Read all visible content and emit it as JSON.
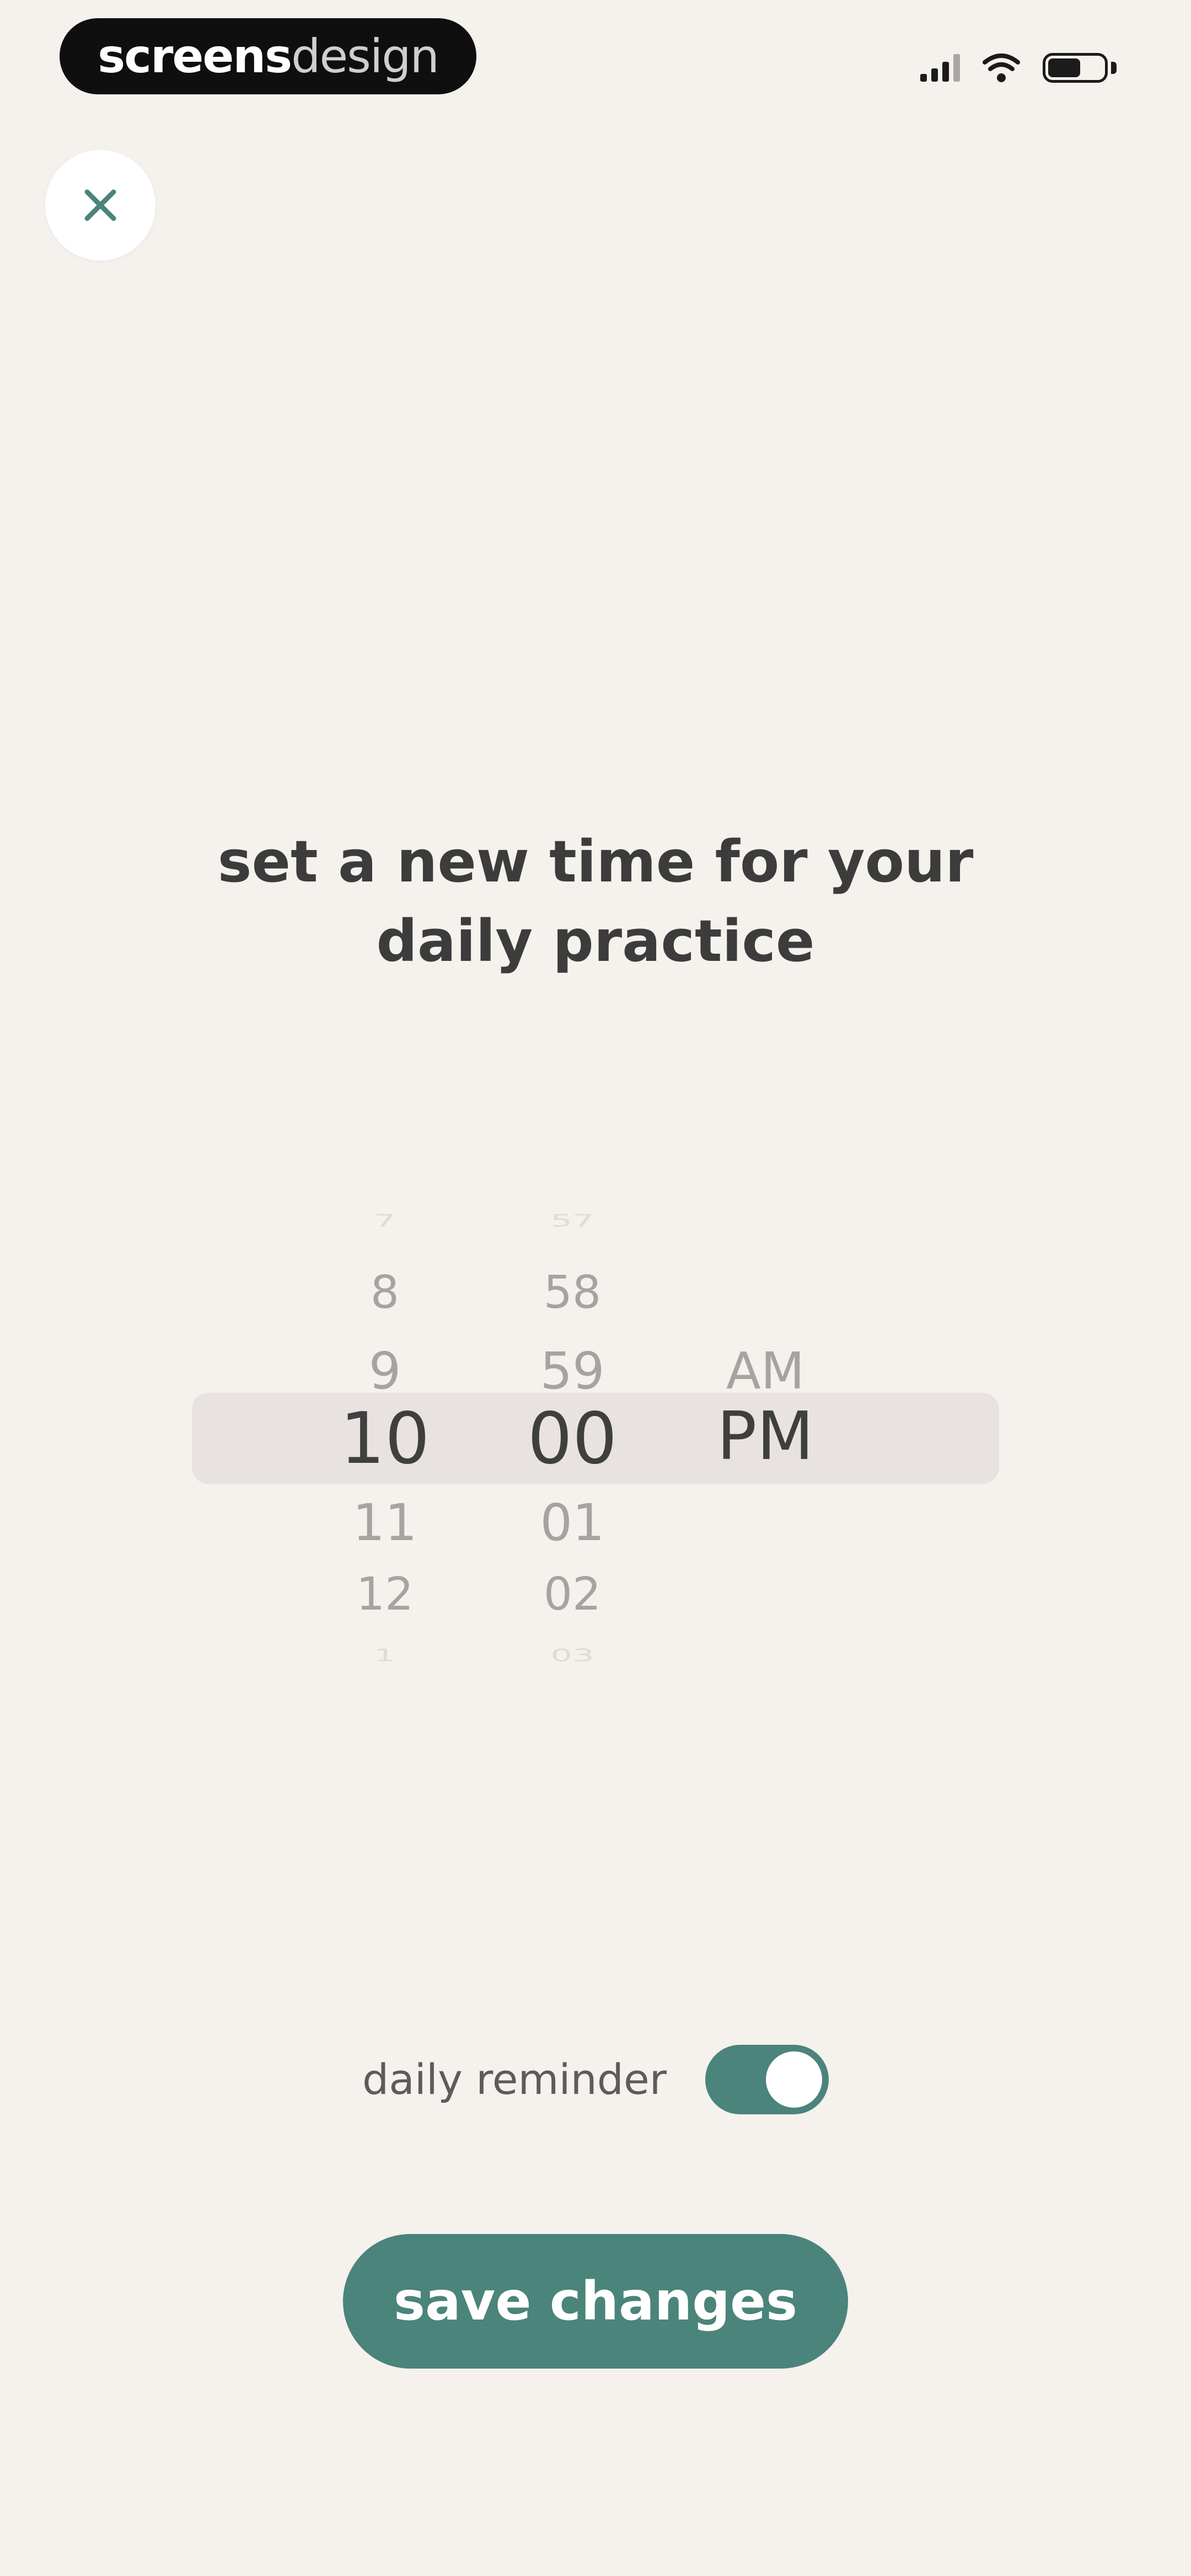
{
  "status_bar": {
    "brand_bold": "screens",
    "brand_light": "design",
    "icons": [
      "signal-icon",
      "wifi-icon",
      "battery-icon"
    ]
  },
  "close_button": {
    "icon": "close-icon"
  },
  "title": {
    "line1": "set a new time for your",
    "line2": "daily practice"
  },
  "time_picker": {
    "hours": [
      "7",
      "8",
      "9",
      "10",
      "11",
      "12",
      "1"
    ],
    "minutes": [
      "57",
      "58",
      "59",
      "00",
      "01",
      "02",
      "03"
    ],
    "periods": [
      "AM",
      "PM"
    ],
    "selected": {
      "hour": "10",
      "minute": "00",
      "period": "PM"
    }
  },
  "reminder": {
    "label": "daily reminder",
    "enabled": true
  },
  "save_button": {
    "label": "save changes"
  },
  "colors": {
    "background": "#f5f1ed",
    "accent": "#4a847a",
    "title": "#3c3c3c",
    "picker_dim": "#a7a3a1",
    "picker_highlight": "#e8e3e1"
  }
}
